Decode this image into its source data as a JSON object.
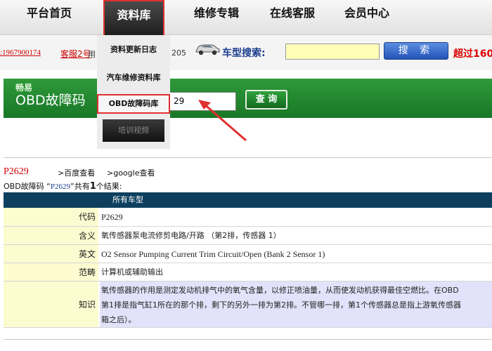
{
  "nav": {
    "items": [
      "平台首页",
      "资料库",
      "维修专辑",
      "在线客服",
      "会员中心"
    ],
    "active": "资料库"
  },
  "dropdown": {
    "items": [
      "资料更新日志",
      "汽车维修资料库",
      "OBD故障码库"
    ],
    "active": "OBD故障码库",
    "video": "培训视频"
  },
  "topbar": {
    "phone": ":1967900174",
    "service_link": "客服2号",
    "service_tail": "用",
    "number": "205",
    "search_label": "车型搜索:",
    "search_value": "",
    "search_button": "搜 索",
    "promo": "超过160"
  },
  "obd": {
    "subtitle": "畅易",
    "title": "OBD故障码",
    "input_value": "29",
    "query_button": "查 询"
  },
  "result": {
    "code": "P2629",
    "baidu_link": ">百度查看",
    "google_link": ">google查看",
    "summary_prefix": "OBD故障码 “",
    "summary_code": "P2629",
    "summary_mid": "”共有",
    "summary_count": "1",
    "summary_suffix": "个结果:",
    "table_header": "所有车型",
    "rows": [
      {
        "label": "代码",
        "value": "P2629"
      },
      {
        "label": "含义",
        "value": "氧传感器泵电流修剪电路/开路 （第2排，传感器 1）"
      },
      {
        "label": "英文",
        "value": "O2 Sensor Pumping Current Trim Circuit/Open (Bank 2 Sensor 1)"
      },
      {
        "label": "范畴",
        "value": "计算机或辅助输出"
      },
      {
        "label": "知识",
        "lines": [
          "氧传感器的作用是测定发动机排气中的氧气含量，以修正喷油量，从而使发动机获得最佳空燃比。在OBD",
          "第1排是指气缸1所在的那个排，剩下的另外一排为第2排。不管哪一排，第1个传感器总是指上游氧传感器",
          "箱之后）。"
        ]
      }
    ]
  },
  "colors": {
    "green_band": "#1f8a2d",
    "table_header_bg": "#0e3f5e",
    "label_bg": "#fdfbd0",
    "knowledge_bg": "#e2e3fa",
    "highlight_border": "#e03030",
    "code_red": "#cc0000"
  }
}
